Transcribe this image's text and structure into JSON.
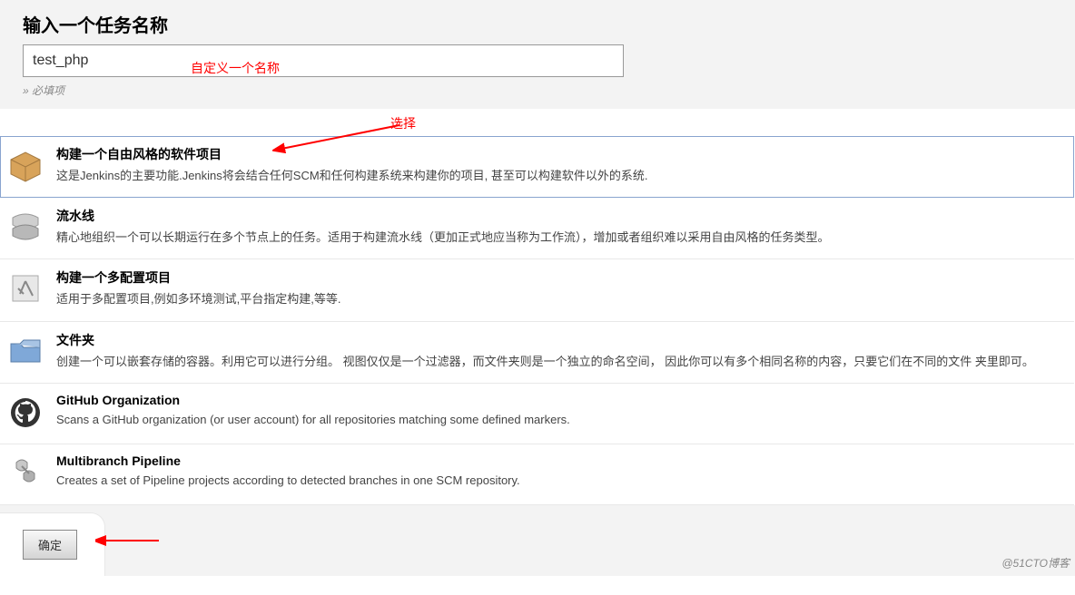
{
  "header": {
    "title": "输入一个任务名称",
    "input_value": "test_php",
    "annotation_name": "自定义一个名称",
    "required_note": "» 必填项"
  },
  "annotation_select": "选择",
  "items": [
    {
      "title": "构建一个自由风格的软件项目",
      "desc": "这是Jenkins的主要功能.Jenkins将会结合任何SCM和任何构建系统来构建你的项目, 甚至可以构建软件以外的系统."
    },
    {
      "title": "流水线",
      "desc": "精心地组织一个可以长期运行在多个节点上的任务。适用于构建流水线（更加正式地应当称为工作流），增加或者组织难以采用自由风格的任务类型。"
    },
    {
      "title": "构建一个多配置项目",
      "desc": "适用于多配置项目,例如多环境测试,平台指定构建,等等."
    },
    {
      "title": "文件夹",
      "desc": "创建一个可以嵌套存储的容器。利用它可以进行分组。 视图仅仅是一个过滤器，而文件夹则是一个独立的命名空间， 因此你可以有多个相同名称的内容，只要它们在不同的文件 夹里即可。"
    },
    {
      "title": "GitHub Organization",
      "desc": "Scans a GitHub organization (or user account) for all repositories matching some defined markers."
    },
    {
      "title": "Multibranch Pipeline",
      "desc": "Creates a set of Pipeline projects according to detected branches in one SCM repository."
    }
  ],
  "footer": {
    "ok_label": "确定"
  },
  "watermark": "@51CTO博客"
}
